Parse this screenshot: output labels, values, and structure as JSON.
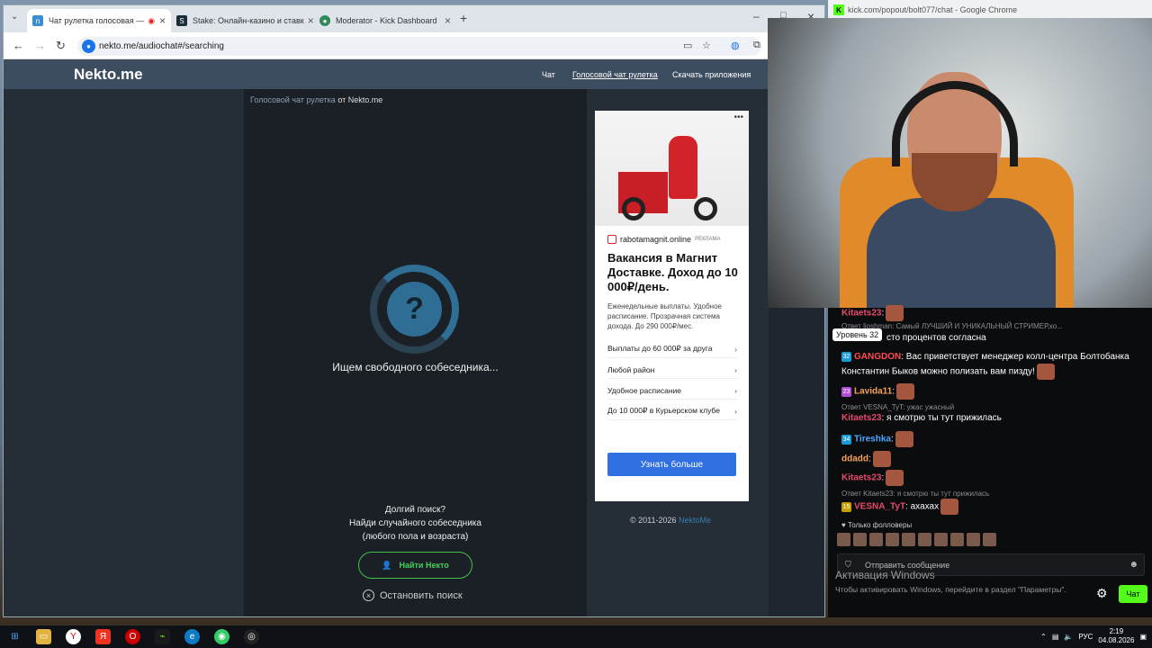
{
  "tabs": [
    {
      "title": "Чат рулетка голосовая —",
      "icon": "nekto-icon"
    },
    {
      "title": "Stake: Онлайн-казино и ставк",
      "icon": "stake-icon"
    },
    {
      "title": "Moderator - Kick Dashboard",
      "icon": "kick-icon"
    }
  ],
  "address": "nekto.me/audiochat#/searching",
  "site": {
    "logo": "Nekto.me",
    "nav": [
      "Чат",
      "Голосовой чат рулетка",
      "Скачать приложения"
    ],
    "crumb_link": "Голосовой чат рулетка",
    "crumb_rest": " от Nekto.me",
    "ring_symbol": "?",
    "searching": "Ищем свободного собеседника...",
    "long_search": [
      "Долгий поиск?",
      "Найди случайного собеседника",
      "(любого пола и возраста)"
    ],
    "find_button": "Найти Некто",
    "stop_button": "Остановить поиск",
    "copyright": "© 2011-2026 ",
    "copyright_link": "NektoMe"
  },
  "ad": {
    "domain": "rabotamagnit.online",
    "label": "РЕКЛАМА",
    "title": "Вакансия в Магнит Доставке. Доход до 10 000₽/день.",
    "text": "Еженедельные выплаты. Удобное расписание. Прозрачная система дохода. До 290 000₽/мес.",
    "links": [
      "Выплаты до 60 000₽ за друга",
      "Любой район",
      "Удобное расписание",
      "До 10 000₽ в Курьерском клубе"
    ],
    "button": "Узнать больше"
  },
  "popout_title": "kick.com/popout/bolt077/chat - Google Chrome",
  "chat": {
    "level_tooltip": "Уровень 32",
    "messages": [
      {
        "user": "Kitaets23",
        "text": ":"
      },
      {
        "reply": "Ответ lioshman: Самый ЛУЧШИЙ И УНИКАЛЬНЫЙ СТРИМЕР,ко..."
      },
      {
        "user": "",
        "text": "сто процентов согласна"
      },
      {
        "user": "GANGDON",
        "badge": "32",
        "text": ": Вас приветствует менеджер колл-центра Болтобанка"
      },
      {
        "user": "",
        "text": "Константин Быков можно полизать вам пизду!"
      },
      {
        "user": "Lavida11",
        "badge": "23",
        "text": ":"
      },
      {
        "reply": "Ответ VESNA_TyT: ужас ужасный"
      },
      {
        "user": "Kitaets23",
        "text": ": я смотрю ты тут прижилась"
      },
      {
        "user": "Tireshka",
        "badge": "34",
        "text": ":"
      },
      {
        "user": "ddadd",
        "text": ":"
      },
      {
        "user": "Kitaets23",
        "text": ":"
      },
      {
        "reply": "Ответ Kitaets23: я смотрю ты тут прижилась"
      },
      {
        "user": "VESNA_TyT",
        "badge": "15",
        "text": ": ахахах"
      }
    ],
    "followers_only": "Только фолловеры",
    "input_placeholder": "Отправить сообщение",
    "send_button": "Чат"
  },
  "windows": {
    "activate_title": "Активация Windows",
    "activate_text": "Чтобы активировать Windows, перейдите в раздел \"Параметры\"."
  },
  "taskbar": {
    "lang": "РУС",
    "time": "2:19",
    "date": "04.08.2026"
  },
  "colors": {
    "accent_green": "#53fc18",
    "nekto_ring": "#2f6f96",
    "ad_button": "#2f6fe2"
  }
}
